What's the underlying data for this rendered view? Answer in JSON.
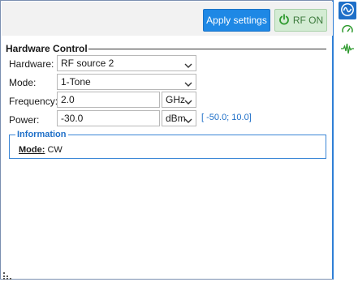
{
  "toolbar": {
    "apply_label": "Apply settings",
    "rf_on_label": "RF ON"
  },
  "section": {
    "title": "Hardware Control"
  },
  "fields": {
    "hardware": {
      "label": "Hardware:",
      "value": "RF source 2"
    },
    "mode": {
      "label": "Mode:",
      "value": "1-Tone"
    },
    "frequency": {
      "label": "Frequency:",
      "value": "2.0",
      "unit": "GHz"
    },
    "power": {
      "label": "Power:",
      "value": "-30.0",
      "unit": "dBm",
      "range": "[ -50.0; 10.0]"
    }
  },
  "information": {
    "title": "Information",
    "mode_key": "Mode:",
    "mode_value": "CW"
  },
  "sidebar": {
    "icons": [
      "waveform-circle-icon",
      "gauge-icon",
      "signal-pulse-icon"
    ]
  },
  "colors": {
    "accent": "#1e88e5",
    "rf_on_bg": "#d4ecd4",
    "rf_on_fg": "#3c7a3c",
    "info_border": "#3a86d6"
  }
}
